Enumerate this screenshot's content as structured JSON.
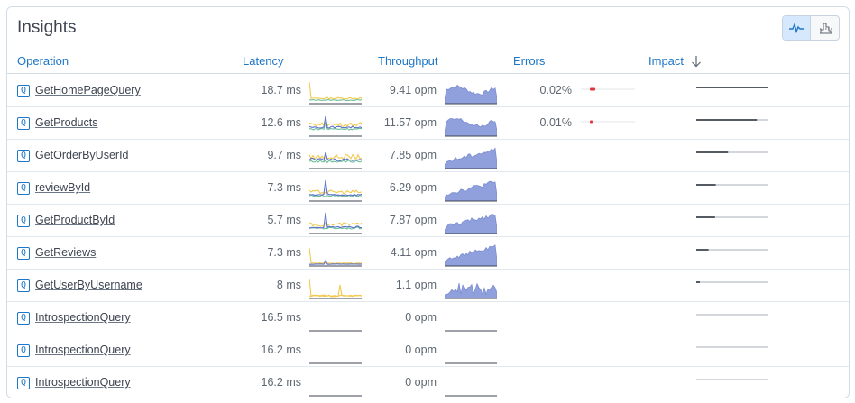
{
  "panel": {
    "title": "Insights"
  },
  "view_toggle": {
    "active": "sparkline-view",
    "icons": [
      "line-chart-icon",
      "distribution-chart-icon"
    ]
  },
  "columns": {
    "operation": "Operation",
    "latency": "Latency",
    "throughput": "Throughput",
    "errors": "Errors",
    "impact": "Impact",
    "impact_sort": "descending"
  },
  "colors": {
    "link": "#1e76c7",
    "throughput_fill": "#8fa0dc",
    "latency_yellow": "#f2c94c",
    "latency_blue": "#5a72c8",
    "latency_green": "#6fbf9a",
    "error_red": "#e0363b",
    "impact_dark": "#555b63",
    "impact_track": "#d3d7dc"
  },
  "rows": [
    {
      "badge": "Q",
      "name": "GetHomePageQuery",
      "latency": "18.7 ms",
      "throughput": "9.41 opm",
      "errors": "0.02%",
      "error_fraction": 0.02,
      "impact": 1.0,
      "lat_profile": "spike-left",
      "thr_profile": "full"
    },
    {
      "badge": "Q",
      "name": "GetProducts",
      "latency": "12.6 ms",
      "throughput": "11.57 opm",
      "errors": "0.01%",
      "error_fraction": 0.01,
      "impact": 0.84,
      "lat_profile": "multi",
      "thr_profile": "full"
    },
    {
      "badge": "Q",
      "name": "GetOrderByUserId",
      "latency": "9.7 ms",
      "throughput": "7.85 opm",
      "errors": "",
      "error_fraction": 0,
      "impact": 0.44,
      "lat_profile": "multi-flat",
      "thr_profile": "rising"
    },
    {
      "badge": "Q",
      "name": "reviewById",
      "latency": "7.3 ms",
      "throughput": "6.29 opm",
      "errors": "",
      "error_fraction": 0,
      "impact": 0.27,
      "lat_profile": "multi-spike",
      "thr_profile": "rising"
    },
    {
      "badge": "Q",
      "name": "GetProductById",
      "latency": "5.7 ms",
      "throughput": "7.87 opm",
      "errors": "",
      "error_fraction": 0,
      "impact": 0.26,
      "lat_profile": "multi-spike",
      "thr_profile": "rising"
    },
    {
      "badge": "Q",
      "name": "GetReviews",
      "latency": "7.3 ms",
      "throughput": "4.11 opm",
      "errors": "",
      "error_fraction": 0,
      "impact": 0.17,
      "lat_profile": "sparse",
      "thr_profile": "rising"
    },
    {
      "badge": "Q",
      "name": "GetUserByUsername",
      "latency": "8 ms",
      "throughput": "1.1 opm",
      "errors": "",
      "error_fraction": 0,
      "impact": 0.05,
      "lat_profile": "sparse-spikes",
      "thr_profile": "jagged"
    },
    {
      "badge": "Q",
      "name": "IntrospectionQuery",
      "latency": "16.5 ms",
      "throughput": "0 opm",
      "errors": "",
      "error_fraction": 0,
      "impact": 0.0,
      "lat_profile": "none",
      "thr_profile": "none"
    },
    {
      "badge": "Q",
      "name": "IntrospectionQuery",
      "latency": "16.2 ms",
      "throughput": "0 opm",
      "errors": "",
      "error_fraction": 0,
      "impact": 0.0,
      "lat_profile": "none",
      "thr_profile": "none"
    },
    {
      "badge": "Q",
      "name": "IntrospectionQuery",
      "latency": "16.2 ms",
      "throughput": "0 opm",
      "errors": "",
      "error_fraction": 0,
      "impact": 0.0,
      "lat_profile": "none",
      "thr_profile": "none"
    }
  ]
}
